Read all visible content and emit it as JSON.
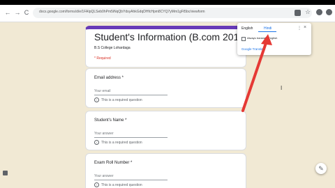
{
  "browser": {
    "url": "docs.google.com/forms/d/e/1FAIpQLSeb0hPm5iNqQbYdsyAhkGdqDHfcHpm8CYQ7yMm1gFt5bc/viewform",
    "back_icon": "←",
    "forward_icon": "→",
    "reload_icon": "C",
    "star_icon": "☆"
  },
  "form": {
    "title": "Student's Information (B.com 2019–2022)",
    "subtitle": "B.S College Lohardaga",
    "required_note": "* Required",
    "questions": [
      {
        "label": "Email address *",
        "placeholder": "Your email",
        "error": "This is a required question"
      },
      {
        "label": "Student's Name *",
        "placeholder": "Your answer",
        "error": "This is a required question"
      },
      {
        "label": "Exam Roll Number *",
        "placeholder": "Your answer",
        "error": "This is a required question"
      }
    ]
  },
  "translate_popup": {
    "tab_english": "English",
    "tab_hindi": "Hindi",
    "checkbox_label": "Always translate English",
    "footer": "Google Translate",
    "close_icon": "×",
    "kebab_icon": "⋮"
  },
  "colors": {
    "accent": "#673ab7",
    "arrow": "#e53935",
    "background": "#f1e9d4"
  }
}
